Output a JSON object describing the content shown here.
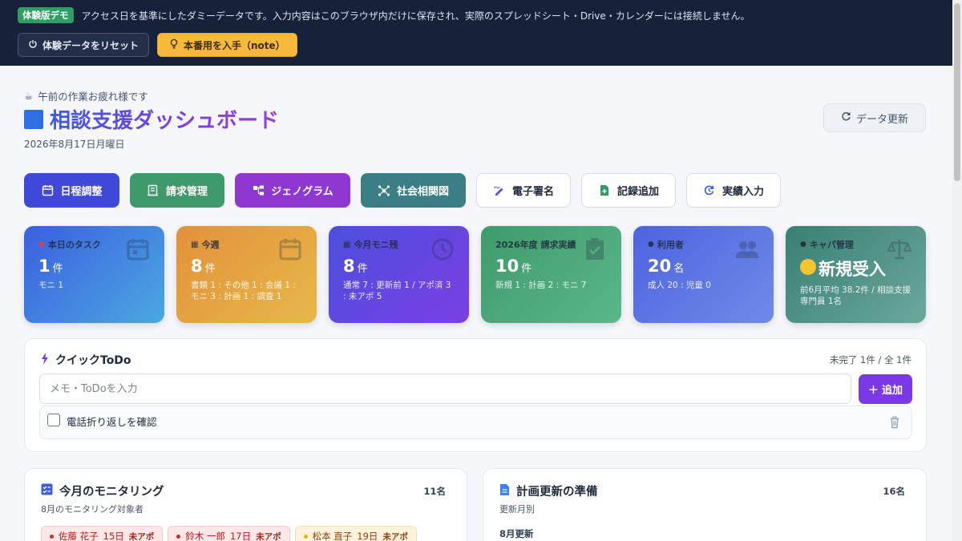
{
  "banner": {
    "badge": "体験版デモ",
    "text": "アクセス日を基準にしたダミーデータです。入力内容はこのブラウザ内だけに保存され、実際のスプレッドシート・Drive・カレンダーには接続しません。",
    "reset_label": "体験データをリセット",
    "note_label": "本番用を入手（note）"
  },
  "header": {
    "greeting_icon": "☕",
    "greeting": "午前の作業お疲れ様です",
    "title": "相談支援ダッシュボード",
    "date": "2026年8月17日月曜日",
    "refresh_label": "データ更新"
  },
  "nav": [
    {
      "label": "日程調整",
      "icon": "calendar-icon",
      "color": "#4048d8"
    },
    {
      "label": "請求管理",
      "icon": "invoice-icon",
      "color": "#3f9a6b"
    },
    {
      "label": "ジェノグラム",
      "icon": "genogram-icon",
      "color": "#8f37d1"
    },
    {
      "label": "社会相関図",
      "icon": "network-icon",
      "color": "#3a7f86"
    },
    {
      "label": "電子署名",
      "icon": "signature-icon",
      "color": ""
    },
    {
      "label": "記録追加",
      "icon": "add-file-icon",
      "color": ""
    },
    {
      "label": "実績入力",
      "icon": "refresh-icon",
      "color": ""
    }
  ],
  "stats": [
    {
      "label": "本日のタスク",
      "value": "1",
      "unit": "件",
      "detail": "モニ 1",
      "icon": "calendar-icon",
      "label_icon": "pin-icon"
    },
    {
      "label": "今週",
      "value": "8",
      "unit": "件",
      "detail": "書類 1 : その他 1 : 会議 1 : モニ 3 : 計画 1 : 調査 1",
      "icon": "calendar-icon",
      "label_icon": "calendar-small-icon"
    },
    {
      "label": "今月モニ残",
      "value": "8",
      "unit": "件",
      "detail": "通常 7 : 更新前 1 / アポ済 3 : 未アポ 5",
      "icon": "clock-icon",
      "label_icon": "calendar-small-icon"
    },
    {
      "label": "2026年度 請求実績",
      "value": "10",
      "unit": "件",
      "detail": "新規 1 : 計画 2 : モニ 7",
      "icon": "clipboard-check-icon",
      "label_icon": ""
    },
    {
      "label": "利用者",
      "value": "20",
      "unit": "名",
      "detail": "成人 20 : 児童 0",
      "icon": "users-icon",
      "label_icon": "user-small-icon"
    },
    {
      "label": "キャパ管理",
      "value": "新規受入",
      "unit": "",
      "detail": "前6月平均 38.2件 / 相談支援専門員 1名",
      "icon": "scale-icon",
      "label_icon": "pin-icon"
    }
  ],
  "todo": {
    "title": "クイックToDo",
    "count": "未完了 1件 / 全 1件",
    "placeholder": "メモ・ToDoを入力",
    "add_label": "追加",
    "items": [
      {
        "text": "電話折り返しを確認"
      }
    ]
  },
  "monitoring": {
    "title": "今月のモニタリング",
    "count": "11名",
    "subtitle": "8月のモニタリング対象者",
    "chips": [
      {
        "name": "佐藤 花子",
        "day": "15日",
        "tag": "未アポ",
        "style": "red"
      },
      {
        "name": "鈴木 一郎",
        "day": "17日",
        "tag": "未アポ",
        "style": "red"
      },
      {
        "name": "松本 直子",
        "day": "19日",
        "tag": "未アポ",
        "style": "yellow"
      }
    ]
  },
  "plan": {
    "title": "計画更新の準備",
    "count": "16名",
    "subtitle": "更新月別",
    "heading": "8月更新"
  },
  "colors": {
    "banner_bg": "#16213a",
    "accent": "#7b38e6",
    "stat_gradients": [
      [
        "#3b5fe0",
        "#4aa8e0"
      ],
      [
        "#e3913a",
        "#e6b84a"
      ],
      [
        "#4b4fdc",
        "#7b3fe4"
      ],
      [
        "#3f9a6b",
        "#5ab78a"
      ],
      [
        "#4d63df",
        "#6f8be8"
      ],
      [
        "#3a7f74",
        "#6aa89a"
      ]
    ]
  }
}
